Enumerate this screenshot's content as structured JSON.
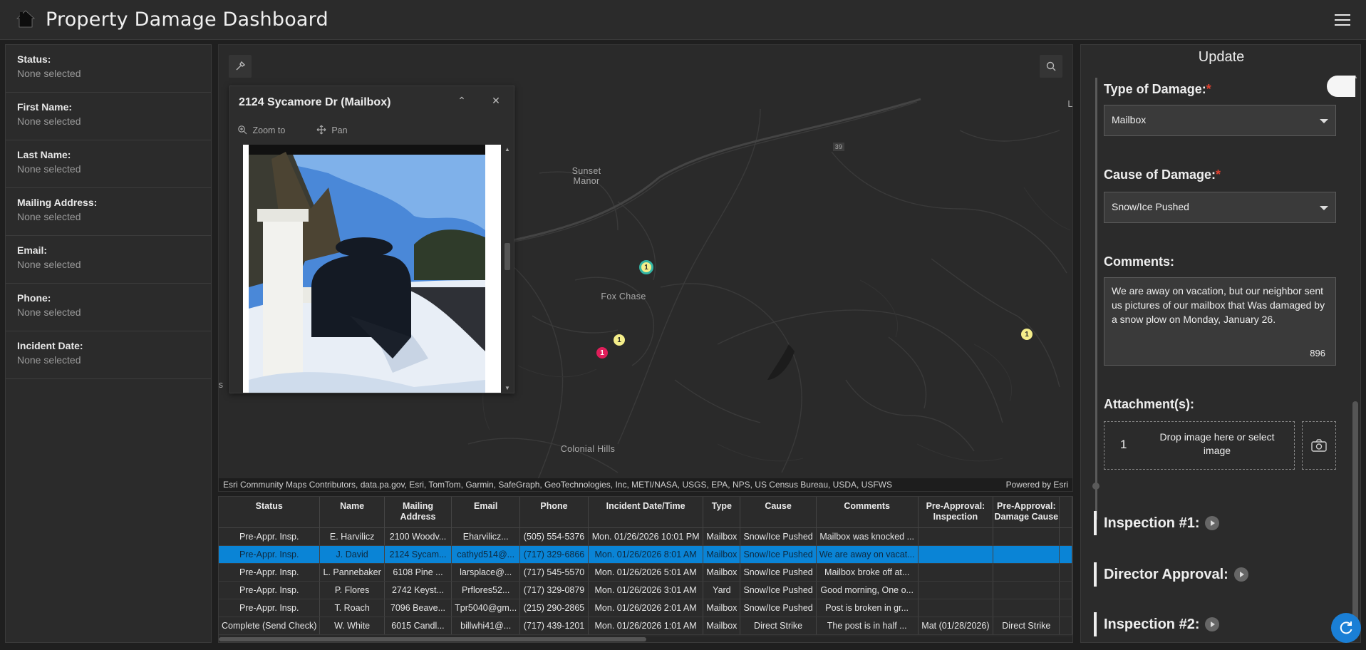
{
  "header": {
    "title": "Property Damage Dashboard"
  },
  "filters": [
    {
      "label": "Status:",
      "value": "None selected"
    },
    {
      "label": "First Name:",
      "value": "None selected"
    },
    {
      "label": "Last Name:",
      "value": "None selected"
    },
    {
      "label": "Mailing Address:",
      "value": "None selected"
    },
    {
      "label": "Email:",
      "value": "None selected"
    },
    {
      "label": "Phone:",
      "value": "None selected"
    },
    {
      "label": "Incident Date:",
      "value": "None selected"
    }
  ],
  "map": {
    "labels": {
      "sunset_manor": "Sunset Manor",
      "fox_chase": "Fox Chase",
      "colonial_hills": "Colonial Hills",
      "route": "39",
      "edge_l": "L",
      "edge_s": "s"
    },
    "markers": [
      {
        "count": "1",
        "color": "#f4ee8a",
        "ring": "#33b5a5"
      },
      {
        "count": "1",
        "color": "#f4ee8a"
      },
      {
        "count": "1",
        "color": "#e01e5a"
      },
      {
        "count": "1",
        "color": "#f4ee8a"
      }
    ],
    "attribution": "Esri Community Maps Contributors, data.pa.gov, Esri, TomTom, Garmin, SafeGraph, GeoTechnologies, Inc, METI/NASA, USGS, EPA, NPS, US Census Bureau, USDA, USFWS",
    "powered_by": "Powered by Esri"
  },
  "popup": {
    "title": "2124 Sycamore Dr (Mailbox)",
    "zoom_to": "Zoom to",
    "pan": "Pan"
  },
  "table": {
    "columns": [
      "Status",
      "Name",
      "Mailing Address",
      "Email",
      "Phone",
      "Incident Date/Time",
      "Type",
      "Cause",
      "Comments",
      "Pre-Approval: Inspection",
      "Pre-Approval: Damage Cause"
    ],
    "rows": [
      [
        "Pre-Appr. Insp.",
        "E. Harvilicz",
        "2100 Woodv...",
        "Eharvilicz...",
        "(505) 554-5376",
        "Mon. 01/26/2026 10:01 PM",
        "Mailbox",
        "Snow/Ice Pushed",
        "Mailbox was knocked ...",
        "",
        ""
      ],
      [
        "Pre-Appr. Insp.",
        "J. David",
        "2124 Sycam...",
        "cathyd514@...",
        "(717) 329-6866",
        "Mon. 01/26/2026 8:01 AM",
        "Mailbox",
        "Snow/Ice Pushed",
        "We are away on vacat...",
        "",
        ""
      ],
      [
        "Pre-Appr. Insp.",
        "L. Pannebaker",
        "6108 Pine ...",
        "larsplace@...",
        "(717) 545-5570",
        "Mon. 01/26/2026 5:01 AM",
        "Mailbox",
        "Snow/Ice Pushed",
        "Mailbox broke off at...",
        "",
        ""
      ],
      [
        "Pre-Appr. Insp.",
        "P. Flores",
        "2742 Keyst...",
        "Prflores52...",
        "(717) 329-0879",
        "Mon. 01/26/2026 3:01 AM",
        "Yard",
        "Snow/Ice Pushed",
        "Good morning, One o...",
        "",
        ""
      ],
      [
        "Pre-Appr. Insp.",
        "T. Roach",
        "7096 Beave...",
        "Tpr5040@gm...",
        "(215) 290-2865",
        "Mon. 01/26/2026 2:01 AM",
        "Mailbox",
        "Snow/Ice Pushed",
        "Post is broken in gr...",
        "",
        ""
      ],
      [
        "Complete (Send Check)",
        "W. White",
        "6015 Candl...",
        "billwhi41@...",
        "(717) 439-1201",
        "Mon. 01/26/2026 1:01 AM",
        "Mailbox",
        "Direct Strike",
        "The post is in half ...",
        "Mat (01/28/2026)",
        "Direct Strike"
      ]
    ],
    "selected_row": 1
  },
  "form": {
    "title": "Update",
    "type_label": "Type of Damage:",
    "type_value": "Mailbox",
    "cause_label": "Cause of Damage:",
    "cause_value": "Snow/Ice Pushed",
    "required_mark": "*",
    "comments_label": "Comments:",
    "comments_value": "We are away on vacation, but our neighbor sent us pictures of our mailbox that Was damaged by a snow plow on Monday, January 26.",
    "comments_remaining": "896",
    "attachments_label": "Attachment(s):",
    "attachment_count": "1",
    "drop_text": "Drop image here or select image",
    "sections": [
      "Inspection #1:",
      "Director Approval:",
      "Inspection #2:"
    ]
  }
}
